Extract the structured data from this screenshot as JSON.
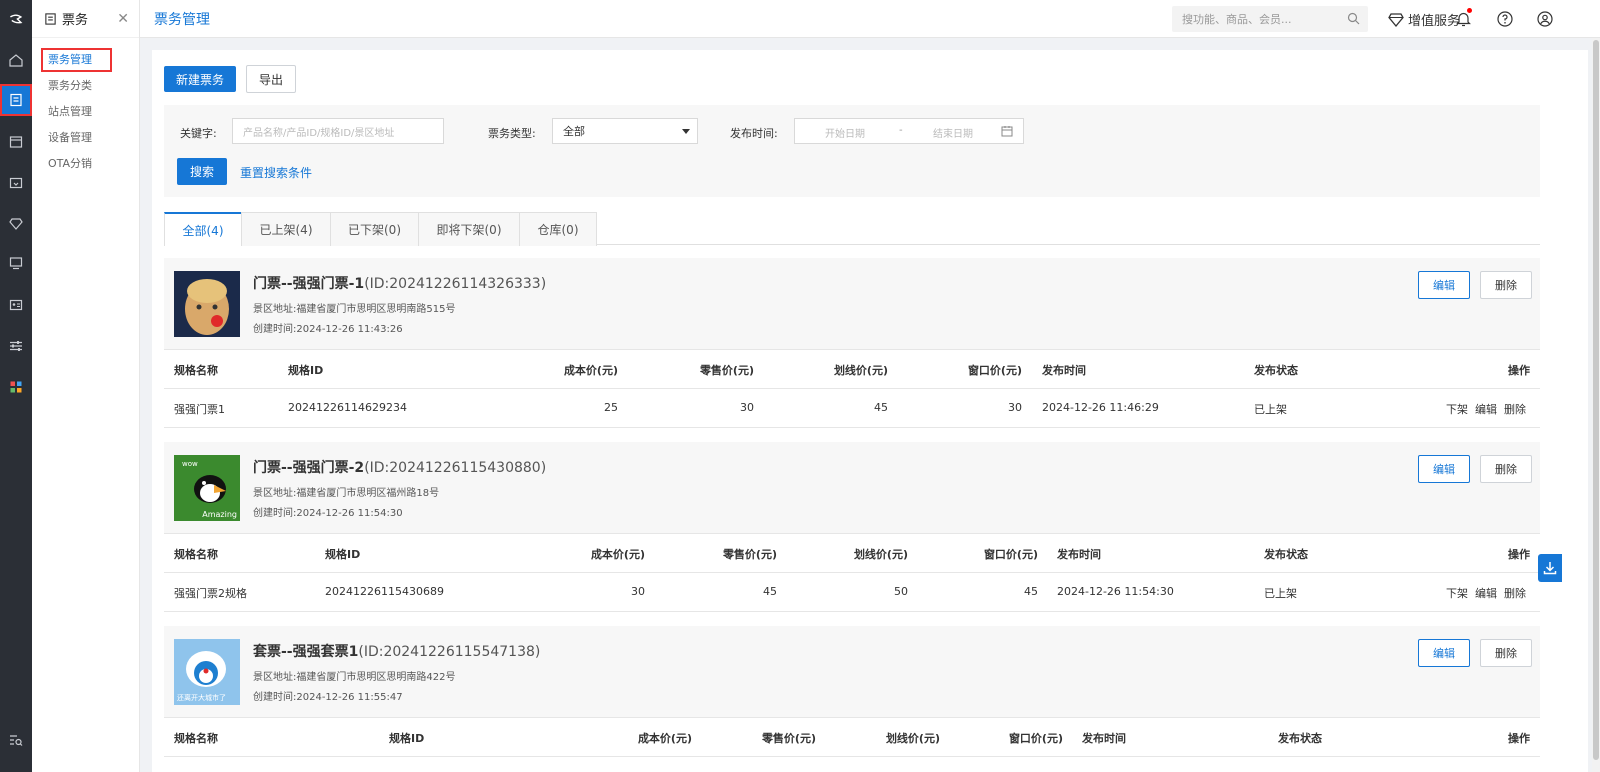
{
  "rail": {
    "logo": "CD",
    "icons": [
      "home-icon",
      "ticket-icon",
      "shop-icon",
      "card-icon",
      "diamond-icon",
      "monitor-icon",
      "id-card-icon",
      "sliders-icon",
      "apps-icon",
      "search-list-icon"
    ]
  },
  "sidebar": {
    "title": "票务",
    "items": [
      {
        "label": "票务管理",
        "active": true
      },
      {
        "label": "票务分类"
      },
      {
        "label": "站点管理"
      },
      {
        "label": "设备管理"
      },
      {
        "label": "OTA分销"
      }
    ]
  },
  "topbar": {
    "title": "票务管理",
    "search_placeholder": "搜功能、商品、会员...",
    "vas_label": "增值服务"
  },
  "toolbar": {
    "new_label": "新建票务",
    "export_label": "导出"
  },
  "filter": {
    "keyword_label": "关键字:",
    "keyword_placeholder": "产品名称/产品ID/规格ID/景区地址",
    "type_label": "票务类型:",
    "type_value": "全部",
    "time_label": "发布时间:",
    "start_placeholder": "开始日期",
    "separator": "-",
    "end_placeholder": "结束日期",
    "search_label": "搜索",
    "reset_label": "重置搜索条件"
  },
  "tabs": [
    {
      "label": "全部(4)",
      "active": true
    },
    {
      "label": "已上架(4)"
    },
    {
      "label": "已下架(0)"
    },
    {
      "label": "即将下架(0)"
    },
    {
      "label": "仓库(0)"
    }
  ],
  "common": {
    "edit_label": "编辑",
    "delete_label": "删除",
    "offshelf_label": "下架",
    "addr_prefix": "景区地址:",
    "time_prefix": "创建时间:",
    "columns": [
      "规格名称",
      "规格ID",
      "成本价(元)",
      "零售价(元)",
      "划线价(元)",
      "窗口价(元)",
      "发布时间",
      "发布状态",
      "操作"
    ]
  },
  "products": [
    {
      "name": "门票--强强门票-1",
      "id_text": "(ID:20241226114326333)",
      "address": "福建省厦门市思明区思明南路515号",
      "created": "2024-12-26 11:43:26",
      "skus": [
        {
          "name": "强强门票1",
          "id": "20241226114629234",
          "cost": "25",
          "retail": "30",
          "strike": "45",
          "window": "30",
          "publish": "2024-12-26 11:46:29",
          "status": "已上架"
        }
      ]
    },
    {
      "name": "门票--强强门票-2",
      "id_text": "(ID:20241226115430880)",
      "address": "福建省厦门市思明区福州路18号",
      "created": "2024-12-26 11:54:30",
      "skus": [
        {
          "name": "强强门票2规格",
          "id": "20241226115430689",
          "cost": "30",
          "retail": "45",
          "strike": "50",
          "window": "45",
          "publish": "2024-12-26 11:54:30",
          "status": "已上架"
        }
      ]
    },
    {
      "name": "套票--强强套票1",
      "id_text": "(ID:20241226115547138)",
      "address": "福建省厦门市思明区思明南路422号",
      "created": "2024-12-26 11:55:47",
      "skus": []
    }
  ],
  "thumb_texts": {
    "wow": "wow",
    "amazing": "Amazing",
    "caption": "还离开大城市了"
  }
}
